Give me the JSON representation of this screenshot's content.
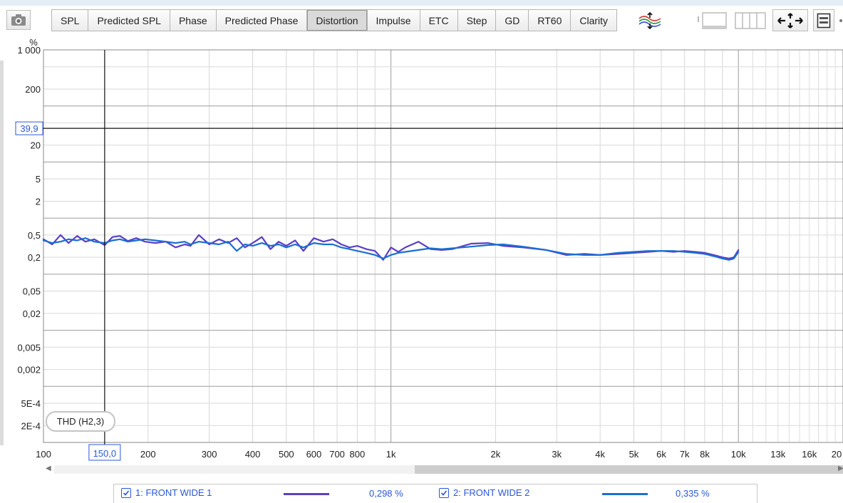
{
  "toolbar": {
    "camera_icon": "camera-icon",
    "tabs": [
      {
        "label": "SPL",
        "active": false
      },
      {
        "label": "Predicted SPL",
        "active": false
      },
      {
        "label": "Phase",
        "active": false
      },
      {
        "label": "Predicted Phase",
        "active": false
      },
      {
        "label": "Distortion",
        "active": true
      },
      {
        "label": "Impulse",
        "active": false
      },
      {
        "label": "ETC",
        "active": false
      },
      {
        "label": "Step",
        "active": false
      },
      {
        "label": "GD",
        "active": false
      },
      {
        "label": "RT60",
        "active": false
      },
      {
        "label": "Clarity",
        "active": false
      }
    ],
    "tools": [
      "trace-arrange-icon",
      "single-graph-icon",
      "multi-graph-icon",
      "pan-zoom-icon",
      "controls-panel-icon"
    ]
  },
  "chart_data": {
    "type": "line",
    "y_unit": "%",
    "x_scale": "log",
    "y_scale": "log",
    "xlim": [
      100,
      20000
    ],
    "ylim": [
      0.0001,
      1000
    ],
    "y_ticks": [
      "1 000",
      "200",
      "20",
      "5",
      "2",
      "0,5",
      "0,2",
      "0,05",
      "0,02",
      "0,005",
      "0,002",
      "5E-4",
      "2E-4"
    ],
    "y_tick_values": [
      1000,
      200,
      20,
      5,
      2,
      0.5,
      0.2,
      0.05,
      0.02,
      0.005,
      0.002,
      0.0005,
      0.0002
    ],
    "x_ticks": [
      "100",
      "200",
      "300",
      "400",
      "500",
      "600",
      "700",
      "800",
      "1k",
      "2k",
      "3k",
      "4k",
      "5k",
      "6k",
      "7k",
      "8k",
      "10k",
      "13k",
      "16k",
      "20"
    ],
    "x_tick_values": [
      100,
      200,
      300,
      400,
      500,
      600,
      700,
      800,
      1000,
      2000,
      3000,
      4000,
      5000,
      6000,
      7000,
      8000,
      10000,
      13000,
      16000,
      20000
    ],
    "cursor": {
      "x": 150,
      "y": 39.9,
      "x_label": "150,0",
      "y_label": "39,9"
    },
    "annotation": "THD (H2,3)",
    "colors": {
      "series1": "#5b3fc4",
      "series2": "#1a6fd1",
      "cursor": "#2b57d8"
    },
    "series": [
      {
        "name": "1: FRONT WIDE 1",
        "x": [
          100,
          106,
          112,
          118,
          125,
          132,
          140,
          150,
          158,
          166,
          175,
          185,
          196,
          210,
          225,
          240,
          255,
          265,
          280,
          300,
          320,
          340,
          360,
          380,
          400,
          425,
          450,
          475,
          500,
          530,
          560,
          600,
          640,
          680,
          720,
          760,
          800,
          850,
          900,
          950,
          1000,
          1050,
          1100,
          1200,
          1300,
          1400,
          1500,
          1700,
          1900,
          2100,
          2400,
          2800,
          3200,
          3600,
          4000,
          4500,
          5000,
          5500,
          6000,
          6500,
          7000,
          7500,
          8000,
          8500,
          9000,
          9400,
          9700,
          10000
        ],
        "values": [
          0.42,
          0.34,
          0.5,
          0.36,
          0.48,
          0.38,
          0.42,
          0.33,
          0.46,
          0.48,
          0.39,
          0.44,
          0.38,
          0.36,
          0.38,
          0.3,
          0.34,
          0.32,
          0.5,
          0.34,
          0.42,
          0.36,
          0.44,
          0.3,
          0.36,
          0.46,
          0.28,
          0.38,
          0.32,
          0.4,
          0.26,
          0.44,
          0.38,
          0.42,
          0.34,
          0.3,
          0.32,
          0.28,
          0.26,
          0.18,
          0.3,
          0.25,
          0.3,
          0.38,
          0.28,
          0.27,
          0.28,
          0.35,
          0.36,
          0.32,
          0.3,
          0.27,
          0.22,
          0.23,
          0.22,
          0.23,
          0.24,
          0.25,
          0.26,
          0.25,
          0.26,
          0.25,
          0.24,
          0.22,
          0.2,
          0.19,
          0.2,
          0.27
        ]
      },
      {
        "name": "2: FRONT WIDE 2",
        "x": [
          100,
          106,
          112,
          118,
          125,
          132,
          140,
          150,
          158,
          166,
          175,
          185,
          196,
          210,
          225,
          240,
          255,
          265,
          280,
          300,
          320,
          340,
          360,
          380,
          400,
          425,
          450,
          475,
          500,
          530,
          560,
          600,
          640,
          680,
          720,
          760,
          800,
          850,
          900,
          950,
          1000,
          1050,
          1100,
          1200,
          1300,
          1400,
          1500,
          1700,
          1900,
          2100,
          2400,
          2800,
          3200,
          3600,
          4000,
          4500,
          5000,
          5500,
          6000,
          6500,
          7000,
          7500,
          8000,
          8500,
          9000,
          9400,
          9700,
          10000
        ],
        "values": [
          0.4,
          0.36,
          0.38,
          0.42,
          0.4,
          0.44,
          0.38,
          0.36,
          0.4,
          0.42,
          0.38,
          0.4,
          0.42,
          0.4,
          0.38,
          0.36,
          0.38,
          0.34,
          0.38,
          0.36,
          0.34,
          0.38,
          0.26,
          0.34,
          0.32,
          0.36,
          0.32,
          0.34,
          0.3,
          0.34,
          0.3,
          0.36,
          0.34,
          0.34,
          0.3,
          0.28,
          0.26,
          0.24,
          0.22,
          0.19,
          0.22,
          0.24,
          0.25,
          0.27,
          0.29,
          0.28,
          0.29,
          0.31,
          0.33,
          0.34,
          0.31,
          0.27,
          0.23,
          0.22,
          0.22,
          0.24,
          0.25,
          0.26,
          0.26,
          0.26,
          0.25,
          0.24,
          0.23,
          0.21,
          0.19,
          0.18,
          0.19,
          0.25
        ]
      }
    ]
  },
  "legend": {
    "items": [
      {
        "label": "1: FRONT WIDE 1",
        "value": "0,298 %",
        "color": "#5b3fc4",
        "checked": true
      },
      {
        "label": "2: FRONT WIDE 2",
        "value": "0,335 %",
        "color": "#1a6fd1",
        "checked": true
      }
    ]
  },
  "scrollbar": {
    "left_arrow": "◀",
    "right_arrow": "▶"
  }
}
